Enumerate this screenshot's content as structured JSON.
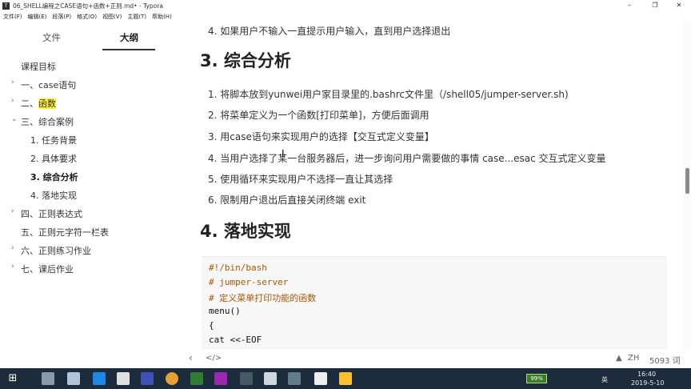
{
  "window": {
    "title": "06_SHELL编程之CASE语句+函数+正则.md• - Typora",
    "icons": [
      "typora-app-icon",
      "minimize-icon",
      "maximize-icon",
      "close-icon"
    ]
  },
  "menu": [
    "文件(F)",
    "编辑(E)",
    "段落(P)",
    "格式(O)",
    "视图(V)",
    "主题(T)",
    "帮助(H)"
  ],
  "sidebar": {
    "tabs": {
      "files": "文件",
      "outline": "大纲"
    },
    "outline": [
      {
        "label": "课程目标"
      },
      {
        "label": "一、case语句"
      },
      {
        "label": "二、",
        "highlight": "函数"
      },
      {
        "label": "三、综合案例"
      },
      {
        "label": "1. 任务背景"
      },
      {
        "label": "2. 具体要求"
      },
      {
        "label": "3. 综合分析"
      },
      {
        "label": "4. 落地实现"
      },
      {
        "label": "四、正则表达式"
      },
      {
        "label": "五、正则元字符一栏表"
      },
      {
        "label": "六、正则练习作业"
      },
      {
        "label": "七、课后作业"
      }
    ]
  },
  "editor": {
    "top_line": "4. 如果用户不输入一直提示用户输入，直到用户选择退出",
    "section3": {
      "heading": "3. 综合分析",
      "items": [
        "1. 将脚本放到yunwei用户家目录里的.bashrc文件里（/shell05/jumper-server.sh)",
        "2. 将菜单定义为一个函数[打印菜单]，方便后面调用",
        "3. 用case语句来实现用户的选择【交互式定义变量】",
        "4. 当用户选择了某一台服务器后，进一步询问用户需要做的事情  case...esac  交互式定义变量",
        "5. 使用循环来实现用户不选择一直让其选择",
        "6. 限制用户退出后直接关闭终端  exit"
      ]
    },
    "section4": {
      "heading": "4. 落地实现",
      "code": [
        "#!/bin/bash",
        "# jumper-server",
        "# 定义菜单打印功能的函数",
        "menu()",
        "{",
        "cat <<-EOF"
      ]
    }
  },
  "statusbar": {
    "back": "‹",
    "source": "</>",
    "warning": "▲",
    "lang": "ZH",
    "words": "5093 词"
  },
  "taskbar": {
    "battery": "99%",
    "ime": "英",
    "time": "16:40",
    "date": "2019-5-10"
  }
}
